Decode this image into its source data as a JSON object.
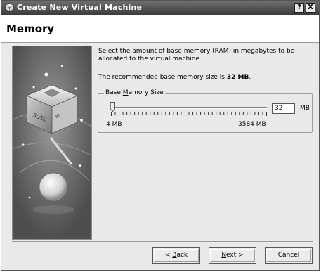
{
  "window": {
    "title": "Create New Virtual Machine",
    "help_label": "?",
    "close_label": "X"
  },
  "page": {
    "title": "Memory"
  },
  "content": {
    "description": "Select the amount of base memory (RAM) in megabytes to be allocated to the virtual machine.",
    "recommended_prefix": "The recommended base memory size is ",
    "recommended_value": "32 MB",
    "recommended_suffix": "."
  },
  "memory_group": {
    "legend_pre": "Base ",
    "legend_mnemonic": "M",
    "legend_post": "emory Size",
    "slider_value_mb": 32,
    "slider_min_mb": 4,
    "slider_max_mb": 3584,
    "spin_value": "32",
    "unit": "MB",
    "min_label": "4 MB",
    "max_label": "3584 MB"
  },
  "buttons": {
    "back_pre": "< ",
    "back_mnemonic": "B",
    "back_post": "ack",
    "next_mnemonic": "N",
    "next_post": "ext >",
    "cancel": "Cancel"
  }
}
